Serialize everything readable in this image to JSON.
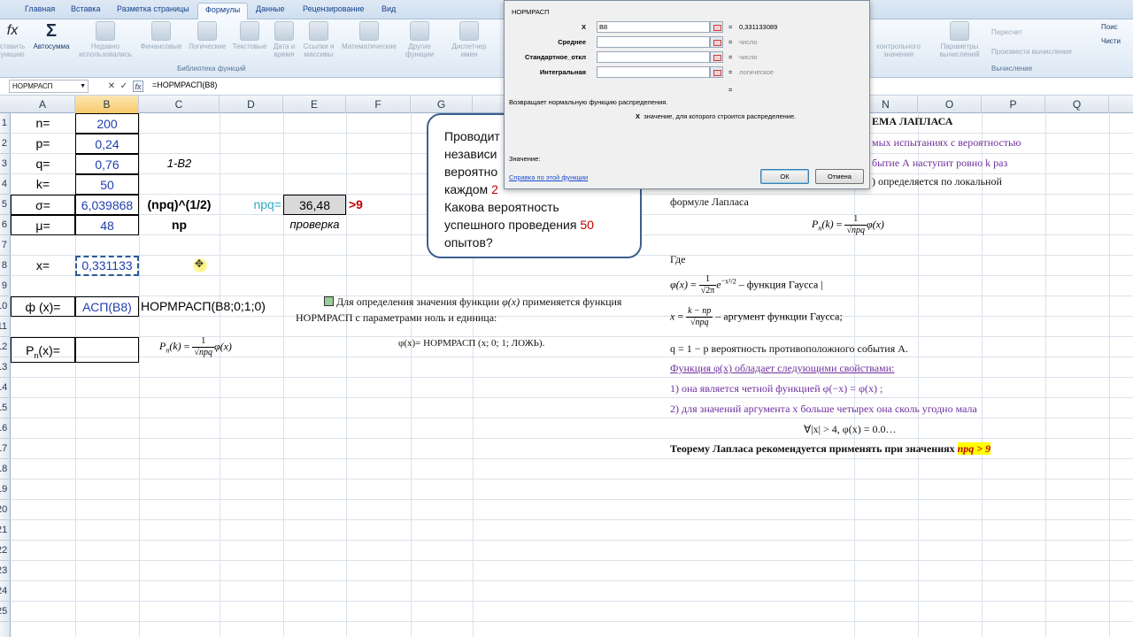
{
  "ribbon": {
    "tabs": [
      "Главная",
      "Вставка",
      "Разметка страницы",
      "Формулы",
      "Данные",
      "Рецензирование",
      "Вид"
    ],
    "buttons": {
      "insert_fn": "ставить\nункцию",
      "autosum": "Автосумма",
      "recent": "Недавно\nиспользовались",
      "financial": "Финансовые",
      "logical": "Логические",
      "text": "Текстовые",
      "datetime": "Дата и\nвремя",
      "lookup": "Ссылки и\nмассивы",
      "math": "Математические",
      "other": "Другие\nфункции",
      "name_mgr": "Диспетчер\nимен",
      "watch": "контрольного\nзначения",
      "calc_params": "Параметры\nвычислений",
      "recalc": "Пересчет",
      "calc_sheet": "Произвести вычисления",
      "search": "Поис",
      "clear": "Чисти"
    },
    "group_library": "Библиотека функций",
    "group_calc": "Вычисление"
  },
  "formula_bar": {
    "name_box": "НОРМРАСП",
    "formula": "=НОРМРАСП(B8)"
  },
  "columns": [
    "A",
    "B",
    "C",
    "D",
    "E",
    "F",
    "G",
    "N",
    "O",
    "P",
    "Q"
  ],
  "rows": [
    "1",
    "2",
    "3",
    "4",
    "5",
    "6",
    "7",
    "8",
    "9",
    "10",
    "11",
    "12",
    "13",
    "14",
    "15",
    "16",
    "17",
    "18",
    "19",
    "20",
    "21",
    "22",
    "23",
    "24",
    "25"
  ],
  "cells": {
    "a1": "n=",
    "b1": "200",
    "a2": "p=",
    "b2": "0,24",
    "a3": "q=",
    "b3": "0,76",
    "c3": "1-B2",
    "a4": "k=",
    "b4": "50",
    "a5": "σ=",
    "b5": "6,039868",
    "c5": "(npq)^(1/2)",
    "d5": "npq=",
    "e5": "36,48",
    "f5": ">9",
    "a6": "μ=",
    "b6": "48",
    "c6": "np",
    "e6": "проверка",
    "a8": "x=",
    "b8": "0,331133",
    "a10": "ф (x)=",
    "b10": "АСП(B8)",
    "c10": "НОРМРАСП(B8;0;1;0)",
    "a12": "P",
    "a12_sub": "n",
    "a12_tail": "(x)="
  },
  "callout": {
    "line1": "Проводит",
    "line2": "независи",
    "line3": "вероятно",
    "line4a": "каждом",
    "line4b": "2",
    "line5": "Какова вероятность",
    "line6a": "успешного проведения",
    "line6b": "50",
    "line7": "опытов?"
  },
  "dialog": {
    "title": "НОРМРАСП",
    "args": [
      {
        "label": "X",
        "value": "B8",
        "result": "0,331133089"
      },
      {
        "label": "Среднее",
        "value": "",
        "result": "число"
      },
      {
        "label": "Стандартное_откл",
        "value": "",
        "result": "число"
      },
      {
        "label": "Интегральная",
        "value": "",
        "result": "логическое"
      }
    ],
    "eq": "=",
    "description": "Возвращает нормальную функцию распределения.",
    "arg_bold": "X",
    "arg_desc": "значение, для которого строится распределение.",
    "value_label": "Значение:",
    "help_link": "Справка по этой функции",
    "ok": "ОК",
    "cancel": "Отмена"
  },
  "middle_note": {
    "line1": "Для определения значения функции",
    "line1b": "применяется функция",
    "line2": "НОРМРАСП с  параметрами ноль и единица:",
    "line3": "φ(x)= НОРМРАСП (x; 0; 1; ЛОЖЬ)."
  },
  "right_notes": {
    "title": "ЕМА ЛАПЛАСА",
    "l1": "мых испытаниях с вероятностью",
    "l2": "бытие А наступит ровно k раз",
    "l3": ") определяется по локальной",
    "l4": "формуле Лапласа",
    "gde": "Где",
    "gauss": "–  функция Гаусса",
    "arg": "–  аргумент функции Гаусса;",
    "q": "q = 1 − p   вероятность противоположного события А.",
    "props": "Функция φ(x) обладает следующими свойствами:",
    "p1": "1) она является четной функцией φ(−x) = φ(x) ;",
    "p2": "2) для значений аргумента x больше четырех она сколь угодно мала",
    "p3": "∀|x| > 4, φ(x) = 0.0…",
    "final": "Теорему Лапласа рекомендуется применять при значениях",
    "final_hl": "npq > 9"
  },
  "colors": {
    "accent_blue": "#1f3fae",
    "red": "#c00000",
    "teal": "#31a9c7",
    "purple": "#7030a0"
  }
}
